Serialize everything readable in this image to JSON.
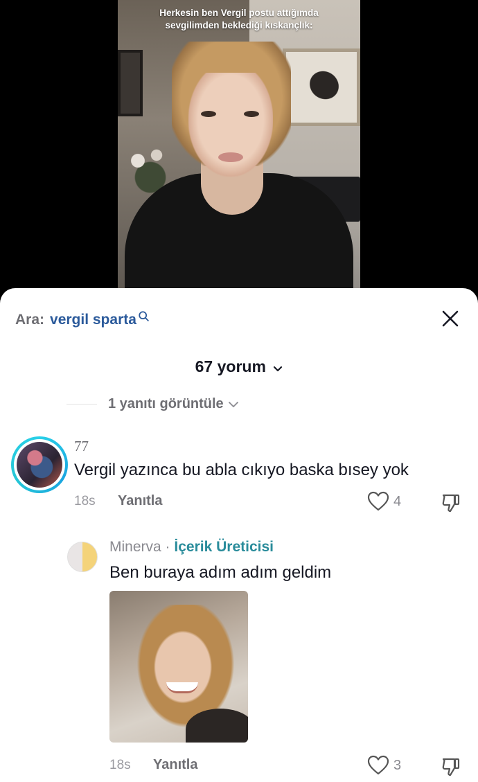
{
  "video": {
    "caption": "Herkesin ben Vergil postu attığımda sevgilimden beklediği kıskançlık:"
  },
  "sheet": {
    "search_prefix": "Ara:",
    "search_term": "vergil sparta",
    "comment_count": "67 yorum",
    "view_replies": "1 yanıtı görüntüle"
  },
  "comments": [
    {
      "username": "77",
      "text": "Vergil yazınca bu abla cıkıyo baska bısey yok",
      "time": "18s",
      "reply_label": "Yanıtla",
      "likes": "4"
    }
  ],
  "reply": {
    "username": "Minerva",
    "separator": "·",
    "badge": "İçerik Üreticisi",
    "text": "Ben buraya adım adım geldim",
    "time": "18s",
    "reply_label": "Yanıtla",
    "likes": "3"
  },
  "colors": {
    "accent_link": "#2b5a9b",
    "creator_badge": "#2a8c9b",
    "avatar_ring": "#2ad0e8"
  },
  "icons": [
    "search-icon",
    "close-icon",
    "chevron-down-icon",
    "heart-icon",
    "dislike-icon"
  ]
}
